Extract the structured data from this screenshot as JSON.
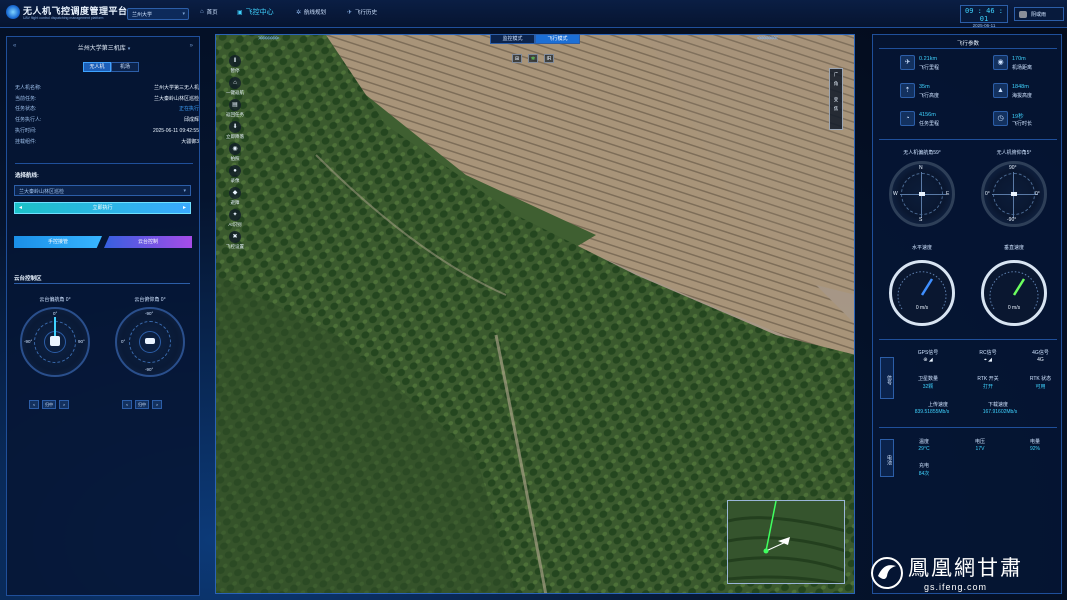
{
  "header": {
    "app_title": "无人机飞控调度管理平台",
    "app_subtitle": "UAV flight control dispatching management platform",
    "site": "兰州大学",
    "nav": [
      {
        "label": "首页",
        "icon": "home-icon"
      },
      {
        "label": "飞控中心",
        "icon": "flight-control-icon"
      },
      {
        "label": "航线规划",
        "icon": "route-icon"
      },
      {
        "label": "飞行历史",
        "icon": "history-icon"
      }
    ],
    "time": "09 : 46 : 01",
    "date": "2025-06-11",
    "weather": "阴或雨"
  },
  "left": {
    "drone_title": "兰州大学第三机库",
    "tabs": [
      "无人机",
      "机场"
    ],
    "info": [
      {
        "k": "无人机名称:",
        "v": "兰州大学第三无人机"
      },
      {
        "k": "当前任务:",
        "v": "兰大秦岭山林区巡检"
      },
      {
        "k": "任务状态:",
        "v": "正在执行"
      },
      {
        "k": "任务执行人:",
        "v": "邱成辉"
      },
      {
        "k": "执行时间:",
        "v": "2025-06-11 09:42:55"
      },
      {
        "k": "挂载组件:",
        "v": "大疆御3"
      }
    ],
    "route_label": "选择航线:",
    "route_value": "兰大秦岭山林区巡检",
    "exec_label": "立即执行",
    "manual_label": "手控接管",
    "gimbal_label": "云台控制",
    "gimbal_section": "云台控制区",
    "gimbal_yaw_label": "云台偏航角 0°",
    "gimbal_pitch_label": "云台俯仰角 0°",
    "dial1_ticks": {
      "top": "0°",
      "left": "-90°",
      "right": "90°"
    },
    "dial2_ticks": {
      "top": "-90°",
      "left": "0°",
      "bottom": "-90°"
    },
    "ctrl_left": [
      "<",
      "归中",
      ">"
    ],
    "ctrl_right": [
      "<",
      "归中",
      ">"
    ]
  },
  "video": {
    "mode_tabs": [
      "监控模式",
      "飞行模式"
    ],
    "active_mode": "飞行模式",
    "tools": [
      {
        "icon": "pause-icon",
        "label": "暂停"
      },
      {
        "icon": "return-home-icon",
        "label": "一键返航"
      },
      {
        "icon": "task-icon",
        "label": "返回任务"
      },
      {
        "icon": "land-icon",
        "label": "立即降落"
      },
      {
        "icon": "camera-icon",
        "label": "拍照"
      },
      {
        "icon": "record-icon",
        "label": "录像"
      },
      {
        "icon": "shield-icon",
        "label": "避障"
      },
      {
        "icon": "ai-icon",
        "label": "AI识别"
      },
      {
        "icon": "settings-icon",
        "label": "飞控设置"
      }
    ],
    "zoom_labels": [
      "广",
      "角",
      "变",
      "焦"
    ]
  },
  "right": {
    "title": "飞行参数",
    "params": [
      {
        "value": "0.21km",
        "label": "飞行里程",
        "icon": "plane-icon"
      },
      {
        "value": "170m",
        "label": "机场距离",
        "icon": "location-icon"
      },
      {
        "value": "35m",
        "label": "飞行高度",
        "icon": "altitude-icon"
      },
      {
        "value": "1848m",
        "label": "海拔高度",
        "icon": "mountain-icon"
      },
      {
        "value": "4156m",
        "label": "任务里程",
        "icon": "odometer-icon"
      },
      {
        "value": "19秒",
        "label": "飞行时长",
        "icon": "timer-icon"
      }
    ],
    "heading_label": "无人机偏航角59°",
    "pitch_label": "无人机俯仰角5°",
    "compass_labels": {
      "n": "N",
      "s": "S",
      "w": "W",
      "e": "E"
    },
    "pitch_ticks": {
      "top": "90°",
      "left": "0°",
      "right": "0°",
      "bottom": "-90°"
    },
    "hspeed_label": "水平速度",
    "vspeed_label": "垂直速度",
    "hspeed": "0 m/s",
    "vspeed": "0 m/s",
    "signal_tag": "信号",
    "signals": [
      {
        "label": "GPS信号",
        "value": "",
        "icon": "gps-icon"
      },
      {
        "label": "RC信号",
        "value": "",
        "icon": "rc-icon"
      },
      {
        "label": "4G信号",
        "value": "4G",
        "icon": "4g-icon"
      },
      {
        "label": "卫星数量",
        "value": "32颗",
        "icon": "satellite-icon"
      },
      {
        "label": "RTK 开关",
        "value": "打开",
        "icon": "rtk-switch-icon"
      },
      {
        "label": "RTK 状态",
        "value": "可用",
        "icon": "rtk-status-icon"
      }
    ],
    "upload_label": "上传速度",
    "upload": "839.51855Mb/s",
    "download_label": "下载速度",
    "download": "167.91602Mb/s",
    "battery_tag": "电池",
    "battery": [
      {
        "label": "温度",
        "value": "29°C",
        "icon": "thermometer-icon"
      },
      {
        "label": "电压",
        "value": "17V",
        "icon": "voltage-icon"
      },
      {
        "label": "电量",
        "value": "92%",
        "icon": "battery-icon"
      }
    ],
    "charge_label": "充电",
    "charge_value": "84次"
  },
  "watermark": {
    "main": "鳳凰網甘肅",
    "sub": "gs.ifeng.com"
  },
  "colors": {
    "accent": "#3fd3ff",
    "green": "#6dff5f",
    "panel": "#061634"
  }
}
